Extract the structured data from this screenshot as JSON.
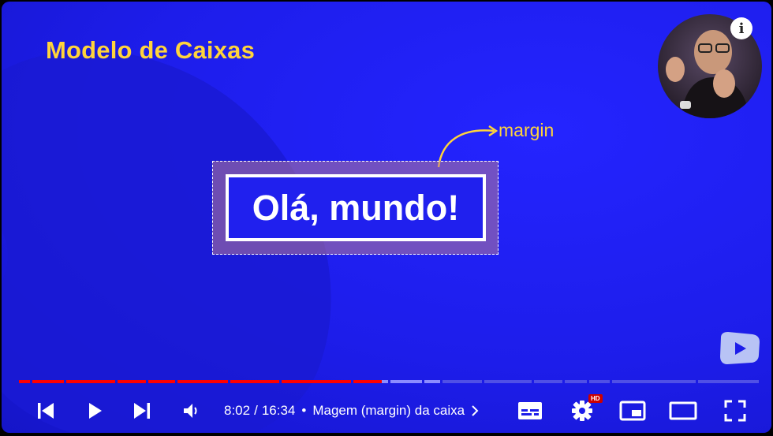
{
  "slide": {
    "title": "Modelo de Caixas",
    "demo_text": "Olá, mundo!",
    "margin_label": "margin"
  },
  "player": {
    "info_label": "i",
    "time_current": "8:02",
    "time_separator": "/",
    "time_total": "16:34",
    "bullet": "•",
    "chapter_title": "Magem (margin) da caixa",
    "hd_badge": "HD",
    "progress_played_fraction": 0.49,
    "colors": {
      "background": "#1d1dea",
      "title": "#ffd43b",
      "played": "#ff0000",
      "buffered": "#8c8cff",
      "unplayed": "#5050e6"
    },
    "icons": [
      "previous-icon",
      "play-icon",
      "next-icon",
      "volume-icon",
      "chevron-right-icon",
      "subtitles-icon",
      "settings-icon",
      "miniplayer-icon",
      "theater-icon",
      "fullscreen-icon"
    ]
  }
}
